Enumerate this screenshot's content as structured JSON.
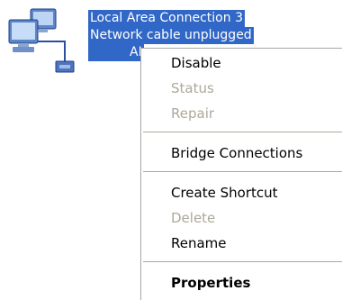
{
  "connection": {
    "name": "Local Area Connection 3",
    "status": "Network cable unplugged",
    "device_partial": "AI"
  },
  "context_menu": {
    "items": [
      {
        "label": "Disable",
        "enabled": true,
        "bold": false
      },
      {
        "label": "Status",
        "enabled": false,
        "bold": false
      },
      {
        "label": "Repair",
        "enabled": false,
        "bold": false
      },
      {
        "label": "Bridge Connections",
        "enabled": true,
        "bold": false
      },
      {
        "label": "Create Shortcut",
        "enabled": true,
        "bold": false
      },
      {
        "label": "Delete",
        "enabled": false,
        "bold": false
      },
      {
        "label": "Rename",
        "enabled": true,
        "bold": false
      },
      {
        "label": "Properties",
        "enabled": true,
        "bold": true
      }
    ]
  },
  "colors": {
    "selection": "#3167c6",
    "disabled_text": "#aca899",
    "separator": "#aca899"
  },
  "icons": {
    "connection": "network-connection-icon"
  }
}
